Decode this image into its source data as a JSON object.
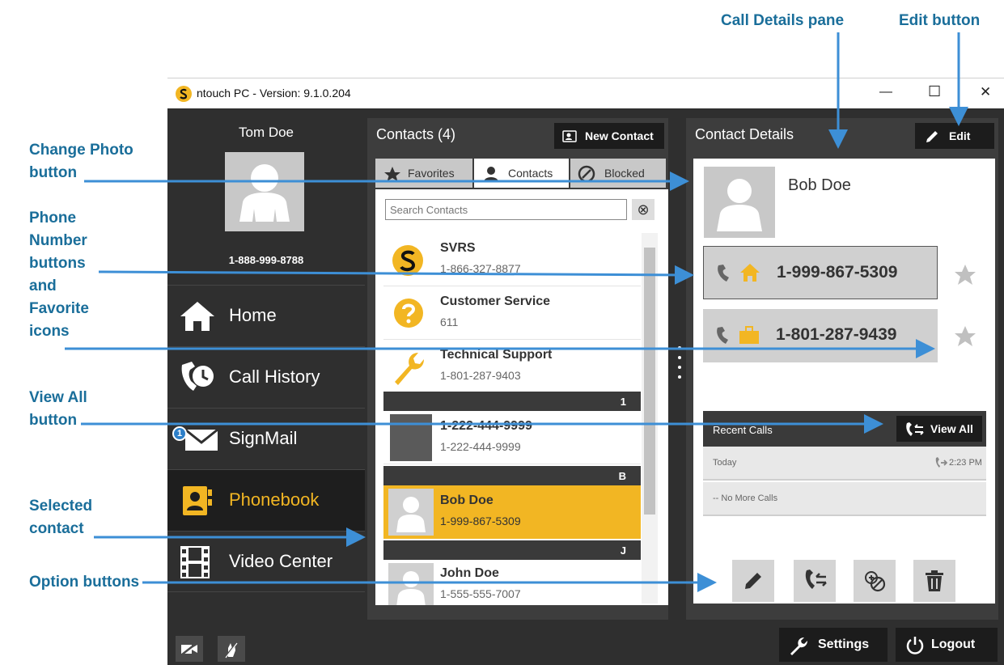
{
  "callouts": {
    "call_details_pane": "Call Details pane",
    "edit_button": "Edit button",
    "change_photo": [
      "Change Photo",
      "button"
    ],
    "phone_numbers": [
      "Phone",
      "Number",
      "buttons",
      "and",
      "Favorite",
      "icons"
    ],
    "view_all": [
      "View All",
      "button"
    ],
    "selected_contact": [
      "Selected",
      "contact"
    ],
    "option_buttons": "Option buttons"
  },
  "window": {
    "title": "ntouch PC  -  Version:  9.1.0.204",
    "controls": {
      "minimize": "—",
      "maximize": "☐",
      "close": "✕"
    }
  },
  "user": {
    "name": "Tom Doe",
    "phone": "1-888-999-8788"
  },
  "nav": [
    {
      "label": "Home",
      "icon": "home-icon"
    },
    {
      "label": "Call History",
      "icon": "call-history-icon"
    },
    {
      "label": "SignMail",
      "icon": "envelope-icon",
      "badge": "1"
    },
    {
      "label": "Phonebook",
      "icon": "phonebook-icon",
      "active": true
    },
    {
      "label": "Video Center",
      "icon": "film-icon"
    }
  ],
  "contacts_panel": {
    "title": "Contacts (4)",
    "new_contact_label": "New Contact",
    "tabs": [
      "Favorites",
      "Contacts",
      "Blocked"
    ],
    "active_tab": "Contacts",
    "search_placeholder": "Search Contacts",
    "clear_icon": "⊗",
    "list": [
      {
        "name": "SVRS",
        "phone": "1-866-327-8877",
        "icon": "svrs-logo-icon"
      },
      {
        "name": "Customer Service",
        "phone": "611",
        "icon": "question-icon"
      },
      {
        "name": "Technical Support",
        "phone": "1-801-287-9403",
        "icon": "wrench-icon"
      }
    ],
    "sections": [
      {
        "header": "1",
        "contacts": [
          {
            "name": "1-222-444-9999",
            "phone": "1-222-444-9999"
          }
        ]
      },
      {
        "header": "B",
        "contacts": [
          {
            "name": "Bob Doe",
            "phone": "1-999-867-5309",
            "selected": true
          }
        ]
      },
      {
        "header": "J",
        "contacts": [
          {
            "name": "John Doe",
            "phone": "1-555-555-7007"
          }
        ]
      }
    ]
  },
  "details_panel": {
    "title": "Contact Details",
    "edit_label": "Edit",
    "contact_name": "Bob Doe",
    "numbers": [
      {
        "number": "1-999-867-5309",
        "type_icon": "home-icon",
        "favorite": true
      },
      {
        "number": "1-801-287-9439",
        "type_icon": "briefcase-icon",
        "favorite": false
      }
    ],
    "recent_calls": {
      "title": "Recent Calls",
      "view_all_label": "View All",
      "rows": [
        {
          "label": "Today",
          "time": "2:23 PM"
        },
        {
          "label": "-- No More Calls",
          "time": ""
        }
      ]
    },
    "option_buttons": [
      "edit-pencil-icon",
      "call-icon",
      "block-icon",
      "trash-icon"
    ]
  },
  "bottom_bar": {
    "settings_label": "Settings",
    "logout_label": "Logout"
  },
  "colors": {
    "accent": "#f2b623",
    "callout": "#1a6e9a",
    "arrow": "#3d8fd6",
    "dark_bg": "#2f2f2f"
  }
}
